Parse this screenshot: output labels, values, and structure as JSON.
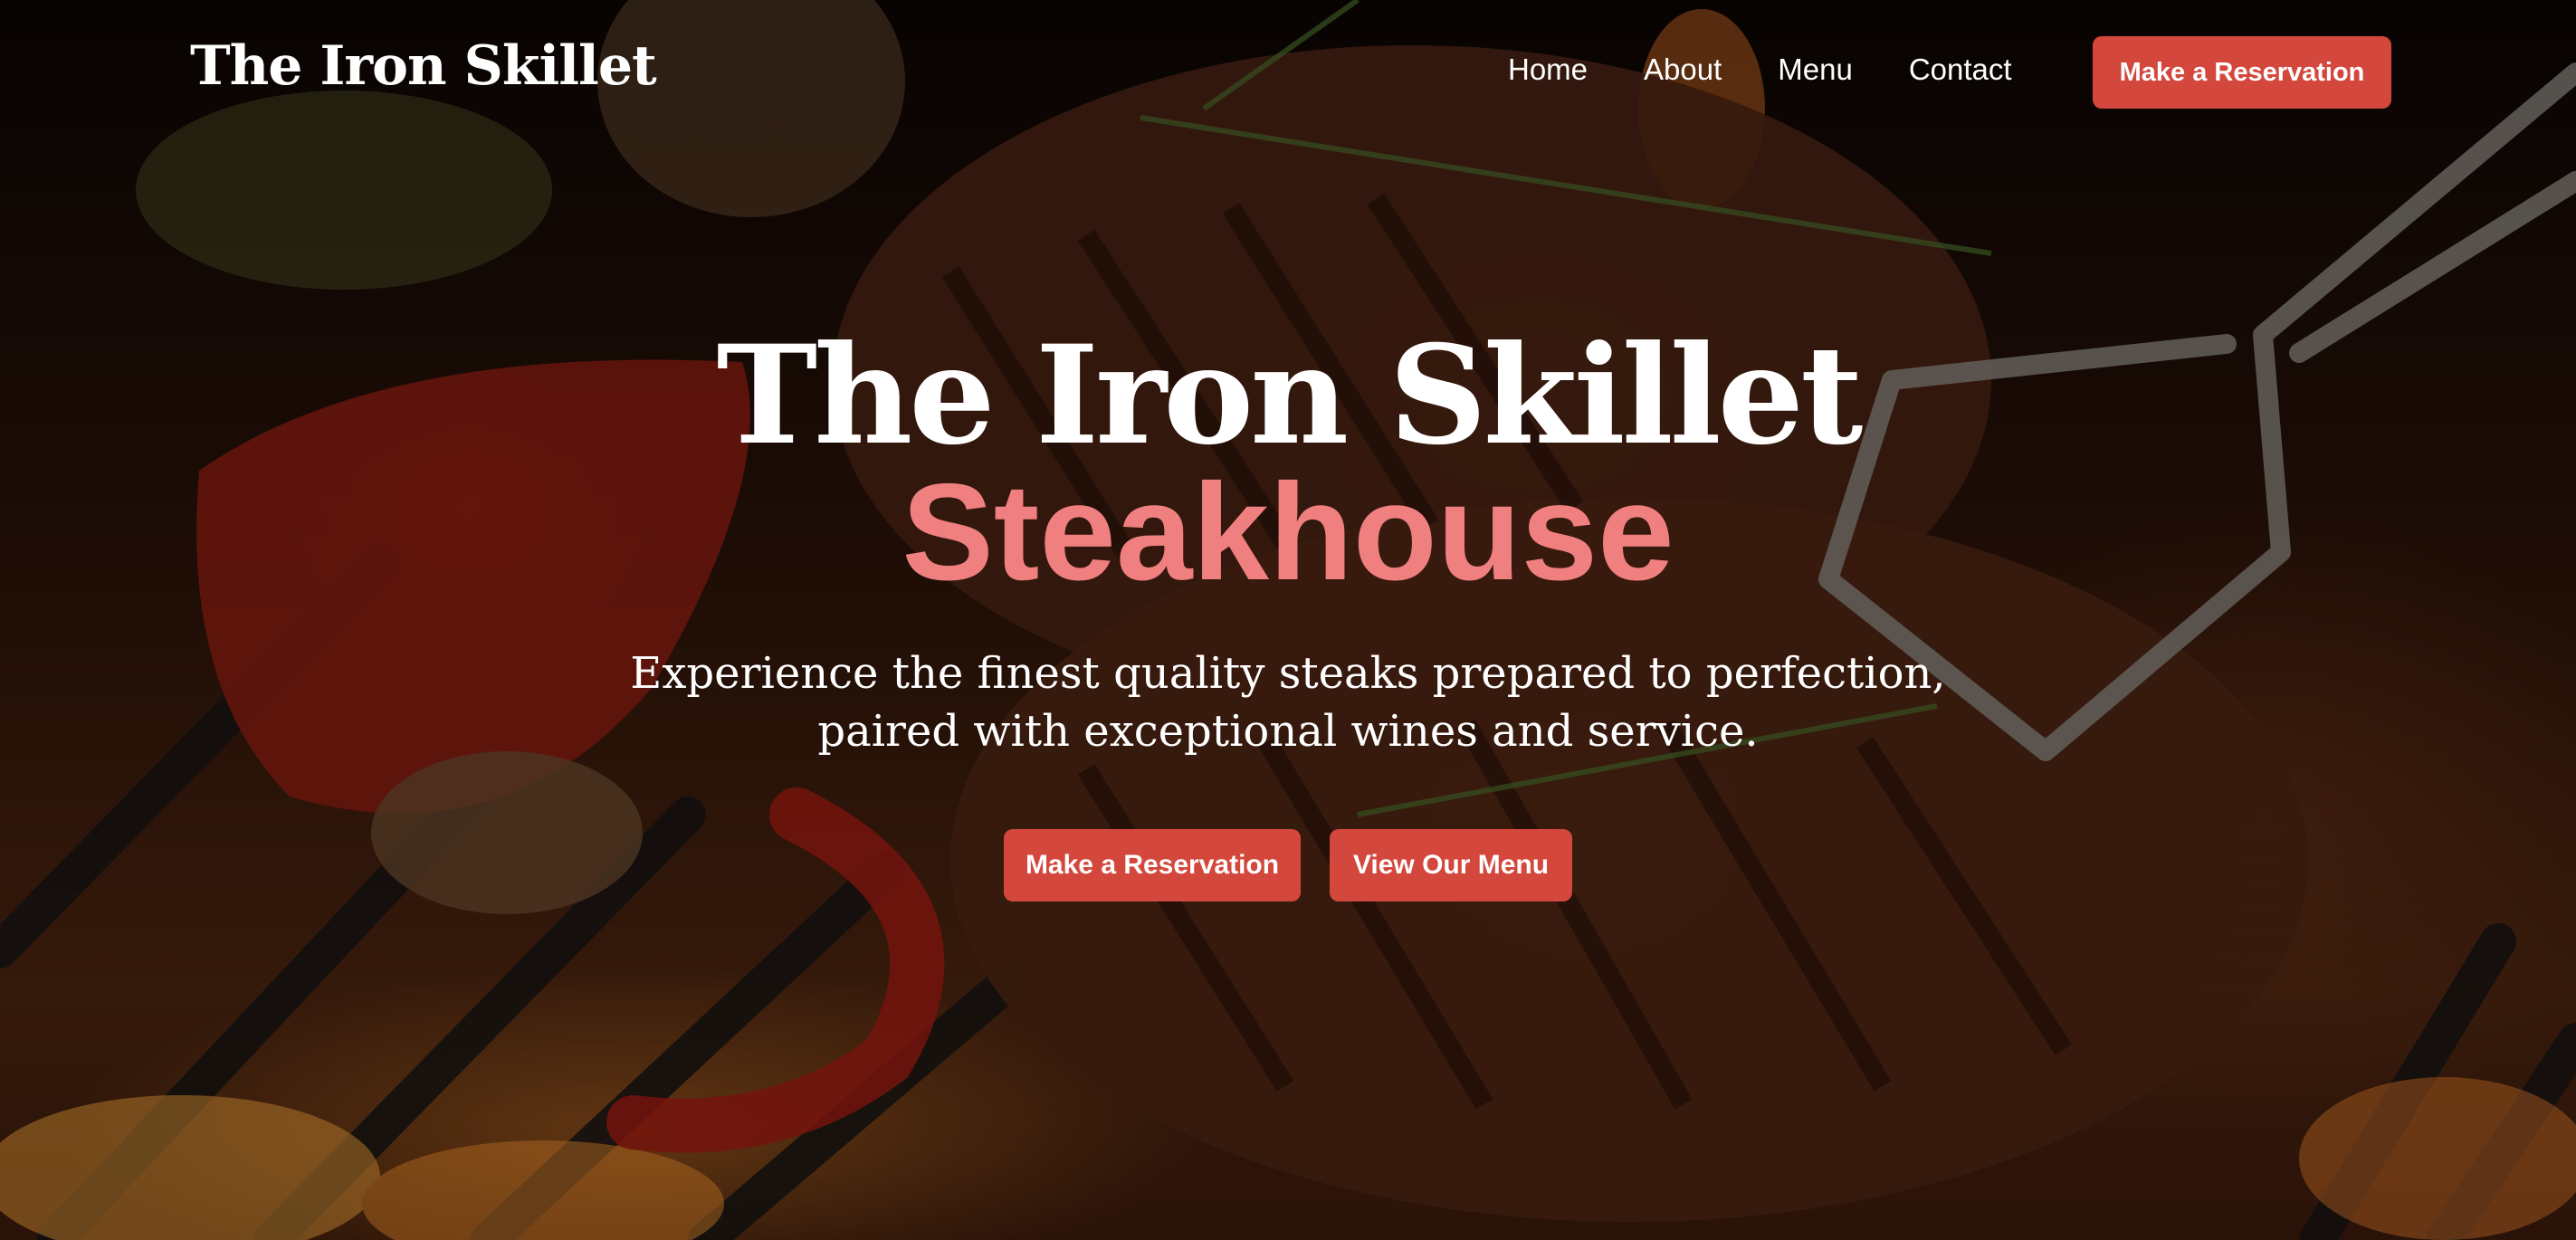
{
  "brand": {
    "name": "The Iron Skillet"
  },
  "nav": {
    "links": [
      "Home",
      "About",
      "Menu",
      "Contact"
    ],
    "cta_label": "Make a Reservation"
  },
  "hero": {
    "title_line1": "The Iron Skillet",
    "title_line2": "Steakhouse",
    "subtitle_line1": "Experience the finest quality steaks prepared to perfection,",
    "subtitle_line2": "paired with exceptional wines and service.",
    "primary_button": "Make a Reservation",
    "secondary_button": "View Our Menu",
    "background_image": "grilled-steak-on-flaming-grill"
  },
  "colors": {
    "accent": "#d4473c",
    "highlight": "#f08080",
    "text": "#ffffff"
  }
}
